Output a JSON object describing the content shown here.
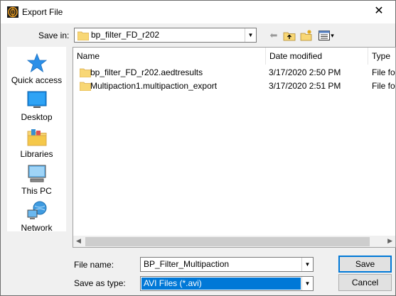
{
  "window": {
    "title": "Export File",
    "close_glyph": "✕"
  },
  "save_in": {
    "label": "Save in:",
    "value": "bp_filter_FD_r202"
  },
  "toolbar": {
    "back_glyph": "⬅",
    "view_arrow": "▾"
  },
  "places": [
    {
      "label": "Quick access",
      "icon": "quick-access-icon"
    },
    {
      "label": "Desktop",
      "icon": "desktop-icon"
    },
    {
      "label": "Libraries",
      "icon": "libraries-icon"
    },
    {
      "label": "This PC",
      "icon": "this-pc-icon"
    },
    {
      "label": "Network",
      "icon": "network-icon"
    }
  ],
  "file_list": {
    "columns": {
      "name": "Name",
      "date": "Date modified",
      "type": "Type"
    },
    "sort_indicator": "^",
    "rows": [
      {
        "name": "bp_filter_FD_r202.aedtresults",
        "date": "3/17/2020 2:50 PM",
        "type": "File folder"
      },
      {
        "name": "Multipaction1.multipaction_export",
        "date": "3/17/2020 2:51 PM",
        "type": "File folder"
      }
    ]
  },
  "file_name": {
    "label": "File name:",
    "value": "BP_Filter_Multipaction"
  },
  "save_as_type": {
    "label": "Save as type:",
    "value": "AVI Files (*.avi)"
  },
  "buttons": {
    "save": "Save",
    "cancel": "Cancel"
  },
  "scroll": {
    "left_arrow": "◀",
    "right_arrow": "▶"
  },
  "colors": {
    "selection": "#0078d7",
    "folder": "#f8d775"
  }
}
